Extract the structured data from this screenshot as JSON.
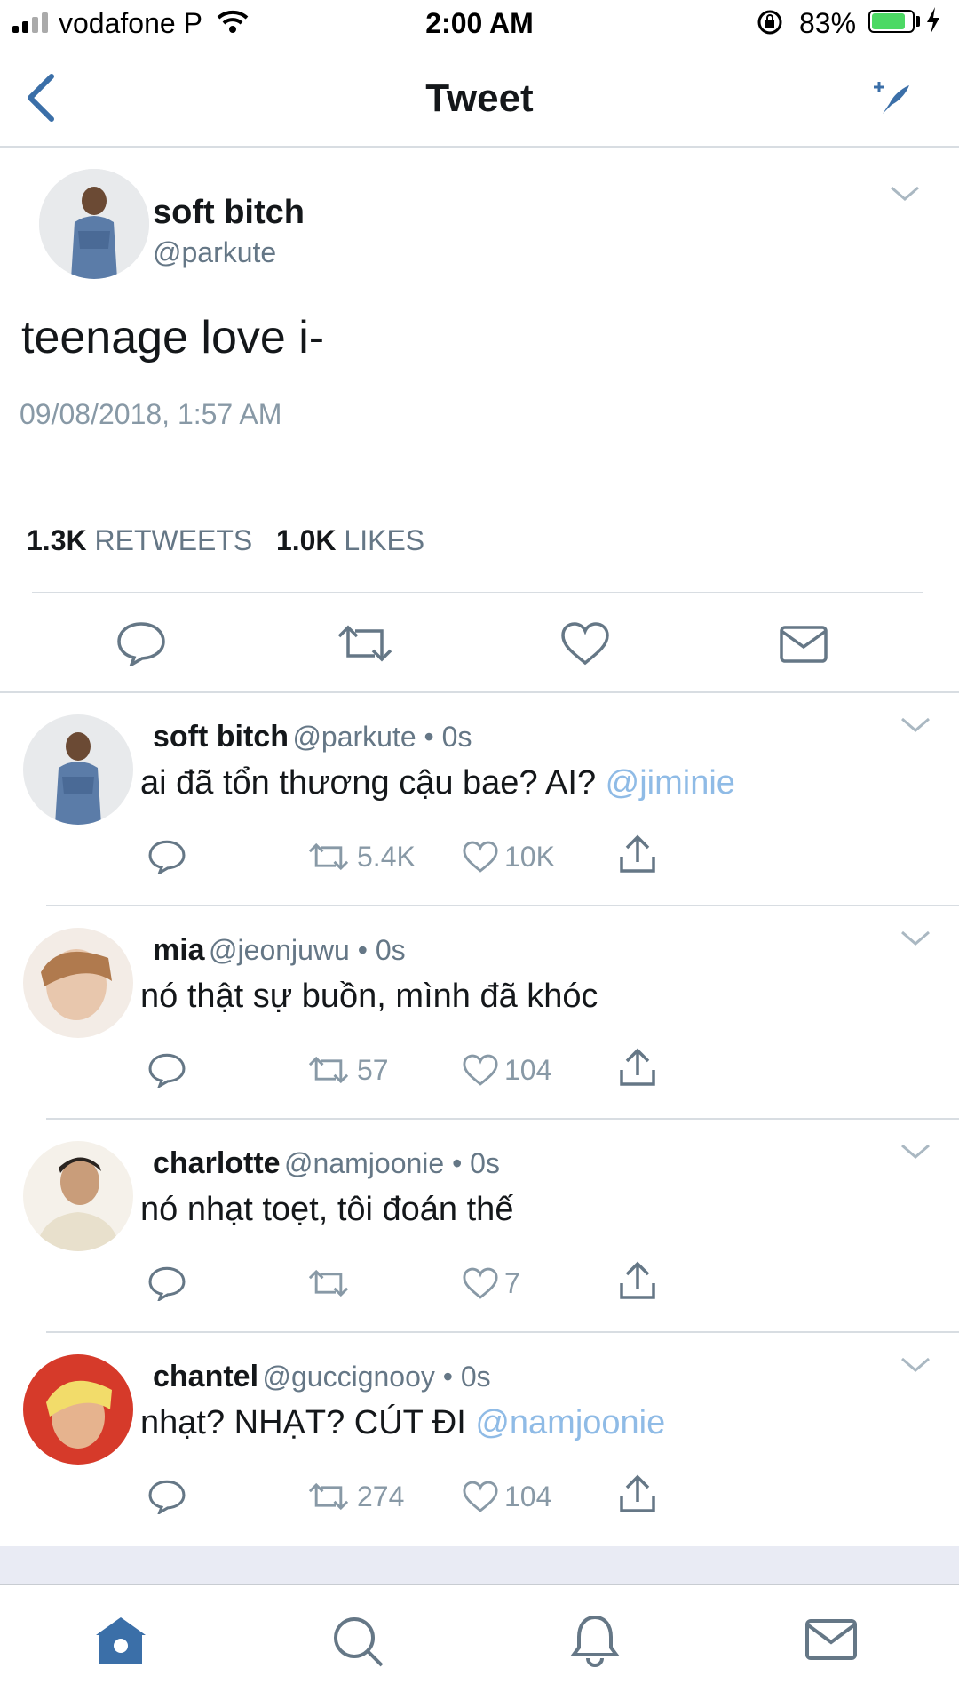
{
  "status_bar": {
    "carrier": "vodafone P",
    "time": "2:00 AM",
    "battery": "83%",
    "battery_level": 0.83
  },
  "nav": {
    "title": "Tweet"
  },
  "tweet": {
    "name": "soft bitch",
    "handle": "@parkute",
    "text": "teenage love i-",
    "timestamp": "09/08/2018, 1:57 AM",
    "retweets_count": "1.3K",
    "retweets_label": "RETWEETS",
    "likes_count": "1.0K",
    "likes_label": "LIKES"
  },
  "replies": [
    {
      "name": "soft bitch",
      "meta": "@parkute • 0s",
      "text": "ai đã tổn thương cậu bae? AI?",
      "mention": "@jiminie",
      "retweets": "5.4K",
      "likes": "10K"
    },
    {
      "name": "mia",
      "meta": "@jeonjuwu • 0s",
      "text": "nó thật sự buồn, mình đã khóc",
      "mention": "",
      "retweets": "57",
      "likes": "104"
    },
    {
      "name": "charlotte",
      "meta": "@namjoonie • 0s",
      "text": "nó nhạt toẹt, tôi đoán thế",
      "mention": "",
      "retweets": "",
      "likes": "7"
    },
    {
      "name": "chantel",
      "meta": "@guccignooy • 0s",
      "text": "nhạt? NHẠT? CÚT ĐI",
      "mention": "@namjoonie",
      "retweets": "274",
      "likes": "104"
    }
  ],
  "colors": {
    "accent": "#3b6fa8",
    "mention": "#8fbbe6",
    "muted": "#657786",
    "battery": "#4cd964"
  },
  "icons": [
    "back-icon",
    "compose-icon",
    "chevron-down-icon",
    "reply-icon",
    "retweet-icon",
    "like-icon",
    "message-icon",
    "share-icon",
    "home-icon",
    "search-icon",
    "notifications-icon"
  ]
}
